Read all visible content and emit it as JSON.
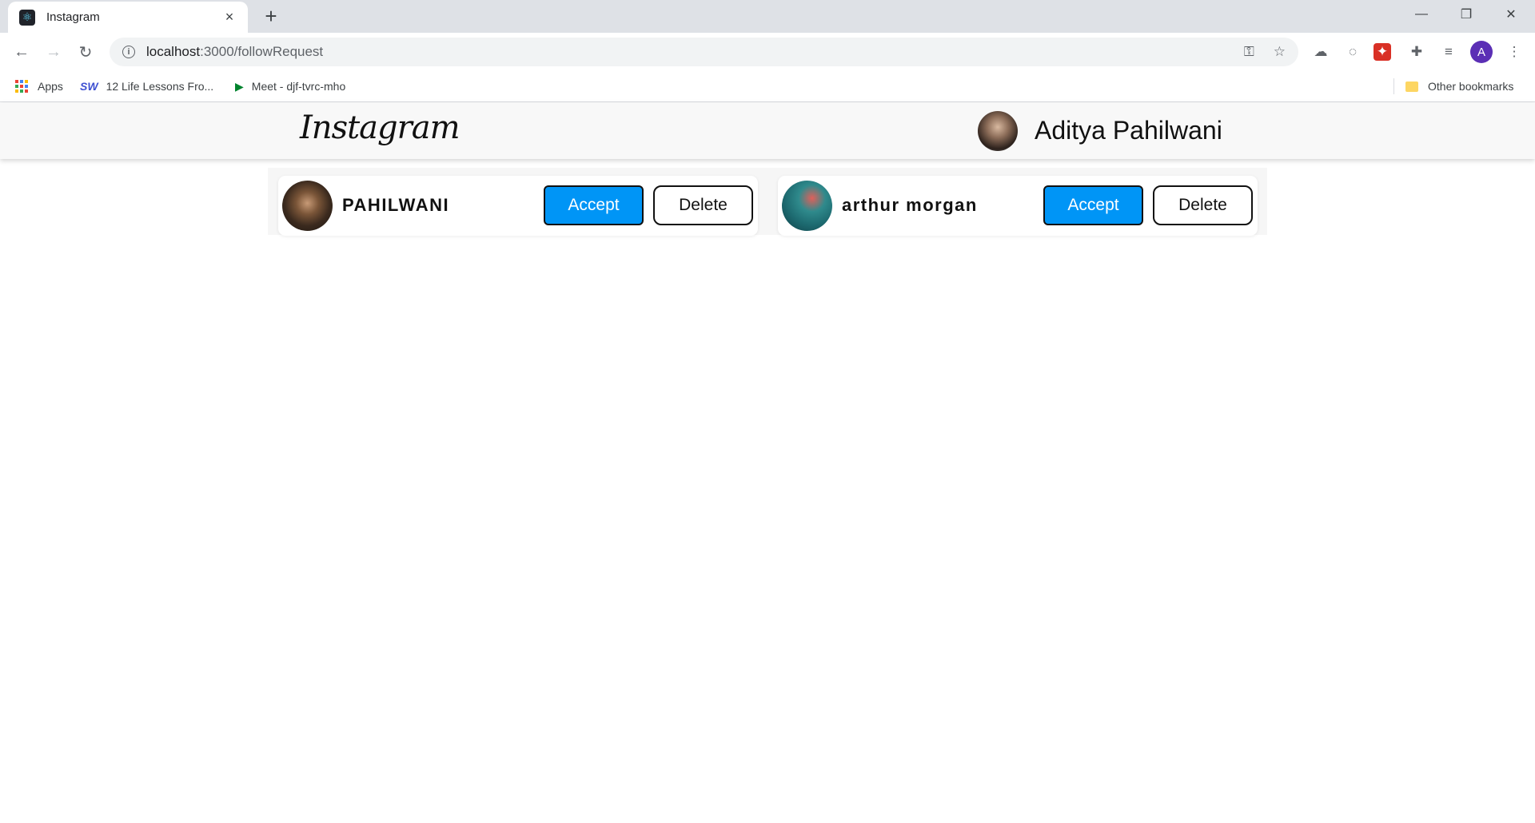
{
  "browser": {
    "tab_title": "Instagram",
    "tab_close": "×",
    "new_tab": "+",
    "url_host": "localhost",
    "url_path": ":3000/followRequest",
    "window_controls": {
      "minimize": "—",
      "restore": "❐",
      "close": "✕"
    },
    "profile_initial": "A",
    "bookmarks": [
      {
        "label": "Apps"
      },
      {
        "label": "12 Life Lessons Fro..."
      },
      {
        "label": "Meet - djf-tvrc-mho"
      }
    ],
    "other_bookmarks": "Other bookmarks"
  },
  "navbar": {
    "logo": "Instagram",
    "user_name": "Aditya Pahilwani"
  },
  "requests": [
    {
      "name": "PAHILWANI",
      "accept_label": "Accept",
      "delete_label": "Delete"
    },
    {
      "name": "arthur morgan",
      "accept_label": "Accept",
      "delete_label": "Delete"
    }
  ],
  "colors": {
    "accept": "#0095f6",
    "navbar_bg": "#f8f8f8"
  }
}
